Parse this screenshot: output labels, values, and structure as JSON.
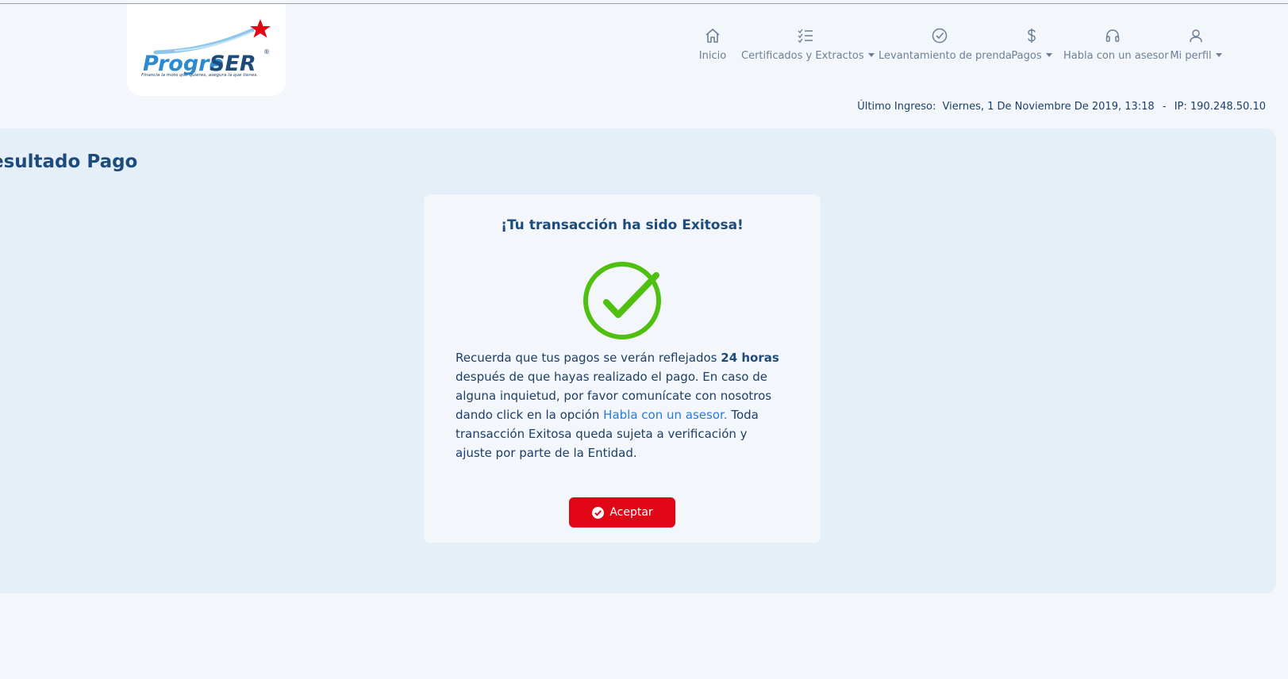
{
  "logo": {
    "brand_prefix": "Progre",
    "brand_suffix": "SER",
    "registered": "®",
    "tagline": "Financia la moto que quieres, asegura la que tienes."
  },
  "nav": {
    "items": [
      {
        "label": "Inicio",
        "icon": "home-icon",
        "dropdown": false
      },
      {
        "label": "Certificados y Extractos",
        "icon": "checklist-icon",
        "dropdown": true
      },
      {
        "label": "Levantamiento de prenda",
        "icon": "check-circle-icon",
        "dropdown": false
      },
      {
        "label": "Pagos",
        "icon": "dollar-icon",
        "dropdown": true
      },
      {
        "label": "Habla con un asesor",
        "icon": "headset-icon",
        "dropdown": false
      },
      {
        "label": "Mi perfil",
        "icon": "user-icon",
        "dropdown": true
      }
    ]
  },
  "last_login": {
    "label": "Último Ingreso:",
    "date": "Viernes, 1 De Noviembre De 2019, 13:18",
    "separator": "-",
    "ip": "IP: 190.248.50.10"
  },
  "page": {
    "title": "esultado Pago"
  },
  "result": {
    "heading": "¡Tu transacción ha sido Exitosa!",
    "message_part1": "Recuerda que tus pagos se verán reflejados ",
    "message_bold": "24 horas",
    "message_part2": " después de que hayas realizado el pago. En caso de alguna inquietud, por favor comunícate con nosotros dando click en la opción ",
    "message_link": "Habla con un asesor.",
    "message_part3": " Toda transacción Exitosa queda sujeta a verificación y ajuste por parte de la Entidad.",
    "button_label": "Aceptar"
  },
  "colors": {
    "primary_dark": "#1d4b7a",
    "accent_red": "#e00616",
    "success_green": "#4fbf10",
    "link_blue": "#2a7bd4",
    "panel_bg": "#e4eff7",
    "page_bg": "#f3f7fb"
  }
}
